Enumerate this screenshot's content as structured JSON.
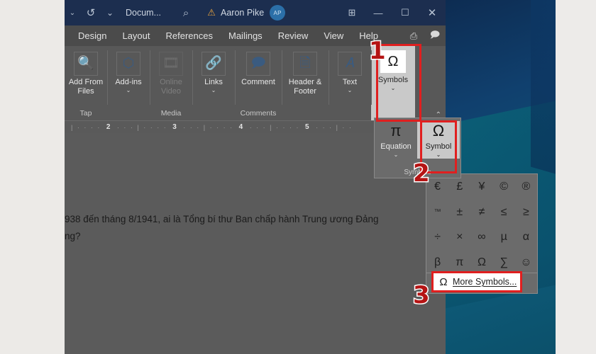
{
  "titlebar": {
    "autosave_chevron": "⌄",
    "undo_icon": "↺",
    "redo_chevron": "⌄",
    "document_name": "Docum...",
    "search_icon": "⌕",
    "warning_icon": "⚠",
    "user_name": "Aaron Pike",
    "avatar_initials": "AP",
    "ribbon_display_icon": "⊞",
    "minimize_icon": "—",
    "maximize_icon": "☐",
    "close_icon": "✕"
  },
  "tabs": [
    {
      "label": "Design"
    },
    {
      "label": "Layout"
    },
    {
      "label": "References"
    },
    {
      "label": "Mailings"
    },
    {
      "label": "Review"
    },
    {
      "label": "View"
    },
    {
      "label": "Help"
    }
  ],
  "tab_icons": [
    {
      "name": "share-icon",
      "glyph": "⎙"
    },
    {
      "name": "comments-icon",
      "glyph": "🗩"
    }
  ],
  "ribbon": {
    "groups": [
      {
        "name": "tap",
        "label": "Tap",
        "buttons": [
          {
            "name": "add-from-files",
            "icon": "🔍",
            "label": "Add From Files",
            "caret": "",
            "disabled": false
          }
        ]
      },
      {
        "name": "addins",
        "label": "",
        "buttons": [
          {
            "name": "add-ins",
            "icon": "⬡",
            "label": "Add-ins",
            "caret": "⌄",
            "disabled": false
          }
        ]
      },
      {
        "name": "media",
        "label": "Media",
        "buttons": [
          {
            "name": "online-video",
            "icon": "🎞",
            "label": "Online Video",
            "caret": "",
            "disabled": true
          }
        ]
      },
      {
        "name": "links",
        "label": "",
        "buttons": [
          {
            "name": "links",
            "icon": "🔗",
            "label": "Links",
            "caret": "⌄",
            "disabled": false
          }
        ]
      },
      {
        "name": "comments",
        "label": "Comments",
        "buttons": [
          {
            "name": "comment",
            "icon": "🗩",
            "label": "Comment",
            "caret": "",
            "disabled": false
          }
        ]
      },
      {
        "name": "headerfooter",
        "label": "",
        "buttons": [
          {
            "name": "header-footer",
            "icon": "🗎",
            "label": "Header & Footer",
            "caret": "⌄",
            "disabled": false
          }
        ]
      },
      {
        "name": "text",
        "label": "",
        "buttons": [
          {
            "name": "text",
            "icon": "𝐴",
            "label": "Text",
            "caret": "⌄",
            "disabled": false
          }
        ]
      }
    ],
    "symbols_button": {
      "icon": "Ω",
      "label": "Symbols",
      "caret": "⌄"
    },
    "collapse_arrow": "⌃",
    "scroll_up": "⌃"
  },
  "ruler": {
    "numbers": [
      "2",
      "3",
      "4",
      "5"
    ],
    "minor_tick": "·",
    "major_tick": "|"
  },
  "document": {
    "lines": [
      "938 đến tháng 8/1941, ai là Tổng bí thư Ban chấp hành Trung ương Đảng",
      "ng?"
    ]
  },
  "symbols_dropdown": {
    "group_label": "Symbols",
    "items": [
      {
        "name": "equation",
        "icon": "π",
        "label": "Equation",
        "caret": "⌄",
        "selected": false
      },
      {
        "name": "symbol",
        "icon": "Ω",
        "label": "Symbol",
        "caret": "⌄",
        "selected": true
      }
    ]
  },
  "symbol_grid": {
    "rows": [
      [
        {
          "glyph": "€",
          "name": "euro-sign"
        },
        {
          "glyph": "£",
          "name": "pound-sign"
        },
        {
          "glyph": "¥",
          "name": "yen-sign"
        },
        {
          "glyph": "©",
          "name": "copyright-sign"
        },
        {
          "glyph": "®",
          "name": "registered-sign"
        }
      ],
      [
        {
          "glyph": "™",
          "name": "trademark-sign"
        },
        {
          "glyph": "±",
          "name": "plus-minus-sign"
        },
        {
          "glyph": "≠",
          "name": "not-equal-sign"
        },
        {
          "glyph": "≤",
          "name": "less-than-or-equal-sign"
        },
        {
          "glyph": "≥",
          "name": "greater-than-or-equal-sign"
        }
      ],
      [
        {
          "glyph": "÷",
          "name": "division-sign"
        },
        {
          "glyph": "×",
          "name": "multiplication-sign"
        },
        {
          "glyph": "∞",
          "name": "infinity-sign"
        },
        {
          "glyph": "µ",
          "name": "micro-sign"
        },
        {
          "glyph": "α",
          "name": "alpha-sign"
        }
      ],
      [
        {
          "glyph": "β",
          "name": "beta-sign"
        },
        {
          "glyph": "π",
          "name": "pi-sign"
        },
        {
          "glyph": "Ω",
          "name": "omega-sign"
        },
        {
          "glyph": "∑",
          "name": "sigma-sign"
        },
        {
          "glyph": "☺",
          "name": "smiley-sign"
        }
      ]
    ]
  },
  "more_symbols": {
    "icon": "Ω",
    "label": "More Symbols..."
  },
  "annotations": {
    "markers": [
      {
        "name": "step-1",
        "text": "1"
      },
      {
        "name": "step-2",
        "text": "2"
      },
      {
        "name": "step-3",
        "text": "3"
      }
    ],
    "highlight_color": "#e01f1f",
    "marker_color": "#b51414"
  }
}
